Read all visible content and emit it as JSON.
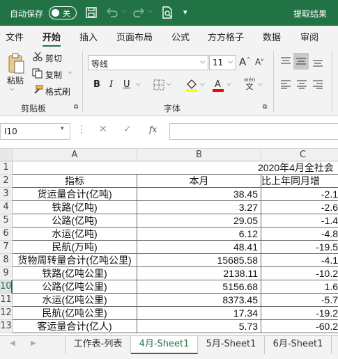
{
  "titlebar": {
    "autosave_label": "自动保存",
    "toggle_state": "关",
    "title": "提取结果",
    "dropdown_glyph": "▾"
  },
  "menu": {
    "tabs": [
      "文件",
      "开始",
      "插入",
      "页面布局",
      "公式",
      "方方格子",
      "数据",
      "审阅"
    ],
    "active": "开始"
  },
  "ribbon": {
    "paste": "粘贴",
    "cut": "剪切",
    "copy": "复制",
    "format_painter": "格式刷",
    "clipboard_group": "剪贴板",
    "font_name": "等线",
    "font_size": "11",
    "font_group": "字体",
    "bold": "B",
    "italic": "I",
    "underline": "U",
    "grow_font": "A",
    "shrink_font": "A",
    "phonetic_top": "wén",
    "phonetic_bottom": "文"
  },
  "formula_bar": {
    "name_box": "I10",
    "fx": "fx",
    "value": ""
  },
  "grid": {
    "columns": [
      "A",
      "B",
      "C"
    ],
    "row_numbers": [
      "1",
      "2",
      "3",
      "4",
      "5",
      "6",
      "7",
      "8",
      "9",
      "10",
      "11",
      "12",
      "13"
    ],
    "selected_row": "10",
    "title_cell": "2020年4月全社会",
    "header": [
      "指标",
      "本月",
      "比上年同月增"
    ],
    "rows": [
      [
        "货运量合计(亿吨)",
        "38.45",
        "-2.1"
      ],
      [
        "铁路(亿吨)",
        "3.27",
        "-2.6"
      ],
      [
        "公路(亿吨)",
        "29.05",
        "-1.4"
      ],
      [
        "水运(亿吨)",
        "6.12",
        "-4.8"
      ],
      [
        "民航(万吨)",
        "48.41",
        "-19.5"
      ],
      [
        "货物周转量合计(亿吨公里)",
        "15685.58",
        "-4.1"
      ],
      [
        "铁路(亿吨公里)",
        "2138.11",
        "-10.2"
      ],
      [
        "公路(亿吨公里)",
        "5156.68",
        "1.6"
      ],
      [
        "水运(亿吨公里)",
        "8373.45",
        "-5.7"
      ],
      [
        "民航(亿吨公里)",
        "17.34",
        "-19.2"
      ],
      [
        "客运量合计(亿人)",
        "5.73",
        "-60.2"
      ]
    ]
  },
  "sheets": {
    "tabs": [
      "工作表-列表",
      "4月-Sheet1",
      "5月-Sheet1",
      "6月-Sheet1"
    ],
    "active": "4月-Sheet1",
    "prev": "◀",
    "next": "▶"
  },
  "colors": {
    "accent": "#217346",
    "ribbon_bg": "#f3f3f3"
  }
}
